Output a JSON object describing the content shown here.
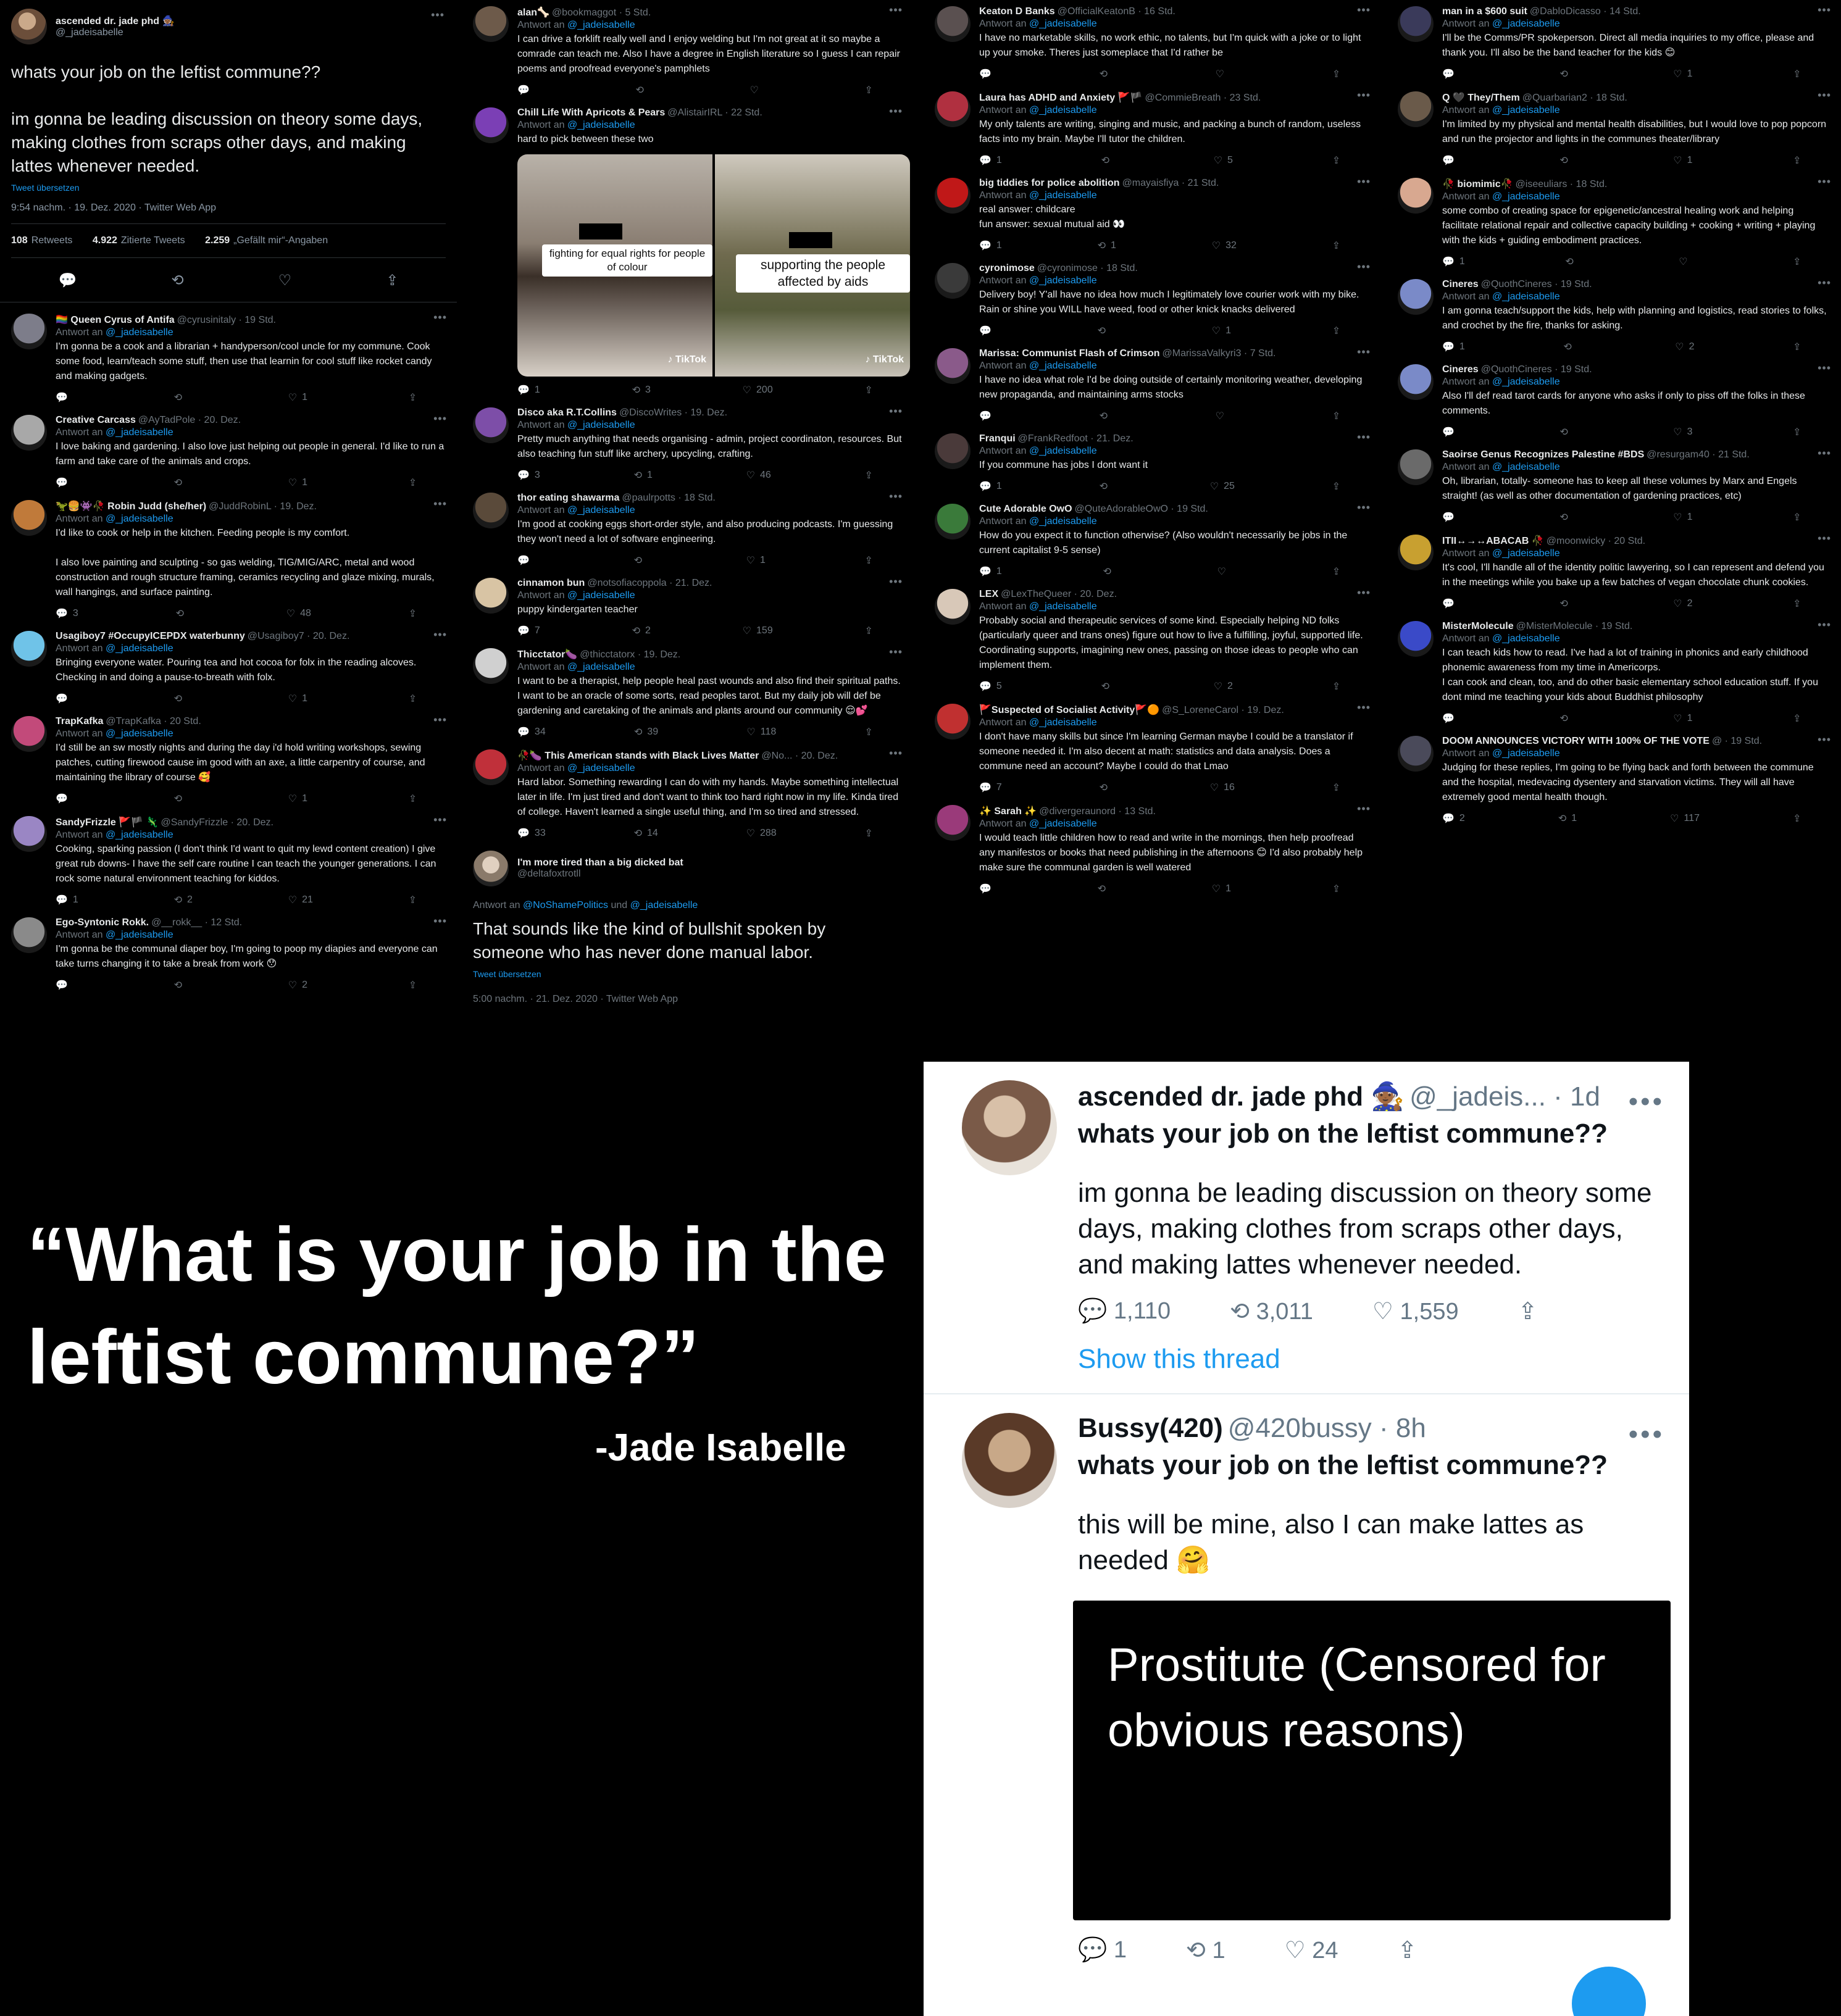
{
  "main_tweet": {
    "name": "ascended dr. jade phd 🧙🏾",
    "handle": "@_jadeisabelle",
    "text": "whats your job on the leftist commune??\n\nim gonna be leading discussion on theory some days, making clothes from scraps other days, and making lattes whenever needed.",
    "translate": "Tweet übersetzen",
    "meta": "9:54 nachm. · 19. Dez. 2020 · Twitter Web App",
    "retweets_count": "108",
    "retweets_label": "Retweets",
    "quotes_count": "4.922",
    "quotes_label": "Zitierte Tweets",
    "likes_count": "2.259",
    "likes_label": "„Gefällt mir“-Angaben"
  },
  "reply_prefix": "Antwort an",
  "reply_to": "@_jadeisabelle",
  "col1": [
    {
      "name": "🏳️‍🌈 Queen Cyrus of Antifa",
      "handle": "@cyrusinitaly · 19 Std.",
      "text": "I'm gonna be a cook and a librarian + handyperson/cool uncle for my commune. Cook some food, learn/teach some stuff, then use that learnin for cool stuff like rocket candy and making gadgets.",
      "reply": "",
      "rt": "",
      "like": "1",
      "color": "#7d7d8a"
    },
    {
      "name": "Creative Carcass",
      "handle": "@AyTadPole · 20. Dez.",
      "text": "I love baking and gardening. I also love just helping out people in general. I'd like to run a farm and take care of the animals and crops.",
      "reply": "",
      "rt": "",
      "like": "1",
      "color": "#a8a8a8"
    },
    {
      "name": "🦖🍔👾🥀 Robin Judd (she/her)",
      "handle": "@JuddRobinL · 19. Dez.",
      "text": "I'd like to cook or help in the kitchen. Feeding people is my comfort.\n\nI also love painting and sculpting - so gas welding, TIG/MIG/ARC, metal and wood construction and rough structure framing, ceramics recycling and glaze mixing, murals, wall hangings, and surface painting.",
      "reply": "3",
      "rt": "",
      "like": "48",
      "color": "#c07a3a"
    },
    {
      "name": "Usagiboy7 #OccupyICEPDX waterbunny",
      "handle": "@Usagiboy7 · 20. Dez.",
      "text": "Bringing everyone water. Pouring tea and hot cocoa for folx in the reading alcoves. Checking in and doing a pause-to-breath with folx.",
      "reply": "",
      "rt": "",
      "like": "1",
      "color": "#6fc3e8"
    },
    {
      "name": "TrapKafka",
      "handle": "@TrapKafka · 20 Std.",
      "text": "I'd still be an sw mostly nights and during the day i'd hold writing workshops, sewing patches, cutting firewood cause im good with an axe, a little carpentry of course, and maintaining the library of course 🥰",
      "reply": "",
      "rt": "",
      "like": "1",
      "color": "#c24a7a"
    },
    {
      "name": "SandyFrizzle 🚩🏴 🦎",
      "handle": "@SandyFrizzle · 20. Dez.",
      "text": "Cooking, sparking passion (I don't think I'd want to quit my lewd content creation) I give great rub downs- I have the self care routine I can teach the younger generations. I can rock some natural environment teaching for kiddos.",
      "reply": "1",
      "rt": "2",
      "like": "21",
      "color": "#9a86c4"
    },
    {
      "name": "Ego-Syntonic Rokk.",
      "handle": "@__rokk__ · 12 Std.",
      "text": "I'm gonna be the communal diaper boy, I'm going to poop my diapies and everyone can take turns changing it to take a break from work 😯",
      "reply": "",
      "rt": "",
      "like": "2",
      "color": "#8a8a8a"
    }
  ],
  "col2": [
    {
      "name": "alan🦴",
      "handle": "@bookmaggot · 5 Std.",
      "text": "I can drive a forklift really well and I enjoy welding but I'm not great at it so maybe a comrade can teach me. Also I have a degree in English literature so I guess I can repair poems and proofread everyone's pamphlets",
      "reply": "",
      "rt": "",
      "like": "",
      "color": "#6d5a4a"
    },
    {
      "name": "Chill Life With Apricots & Pears",
      "handle": "@AlistairIRL · 22 Std.",
      "text": "hard to pick between these two",
      "reply": "1",
      "rt": "3",
      "like": "200",
      "color": "#7b3fb5"
    },
    {
      "name": "Disco aka R.T.Collins",
      "handle": "@DiscoWrites · 19. Dez.",
      "text": "Pretty much anything that needs organising - admin, project coordinaton, resources. But also teaching fun stuff like archery, upcycling, crafting.",
      "reply": "3",
      "rt": "1",
      "like": "46",
      "color": "#7d4ea8"
    },
    {
      "name": "thor eating shawarma",
      "handle": "@paulrpotts · 18 Std.",
      "text": "I'm good at cooking eggs short-order style, and also producing podcasts. I'm guessing they won't need a lot of software engineering.",
      "reply": "",
      "rt": "",
      "like": "1",
      "color": "#5a4a3a"
    },
    {
      "name": "cinnamon bun",
      "handle": "@notsofiacoppola · 21. Dez.",
      "text": "puppy kindergarten teacher",
      "reply": "7",
      "rt": "2",
      "like": "159",
      "color": "#d8c4a4"
    },
    {
      "name": "Thicctator🍆",
      "handle": "@thicctatorx · 19. Dez.",
      "text": "I want to be a therapist, help people heal past wounds and also find their spiritual paths. I want to be an oracle of some sorts, read peoples tarot. But my daily job will def be gardening and caretaking of the animals and plants around our community 😌💕",
      "reply": "34",
      "rt": "39",
      "like": "118",
      "color": "#d0d0d0"
    },
    {
      "name": "🥀🍆 This American stands with Black Lives Matter",
      "handle": "@No... · 20. Dez.",
      "text": "Hard labor. Something rewarding I can do with my hands. Maybe something intellectual later in life. I'm just tired and don't want to think too hard right now in my life. Kinda tired  of college. Haven't learned a single useful thing, and I'm so tired and stressed.",
      "reply": "33",
      "rt": "14",
      "like": "288",
      "color": "#c0303a"
    }
  ],
  "media": {
    "caption_left": "fighting for equal rights for people of colour",
    "caption_right": "supporting the people affected by aids",
    "tiktok": "♪ TikTok"
  },
  "final_reply": {
    "name": "I'm more tired than a big dicked bat",
    "handle": "@deltafoxtrotll",
    "to_prefix": "Antwort an",
    "to_1": "@NoShamePolitics",
    "to_and": "und",
    "to_2": "@_jadeisabelle",
    "text": "That sounds like the kind of bullshit spoken by someone who has never done manual labor.",
    "translate": "Tweet übersetzen",
    "meta": "5:00 nachm. · 21. Dez. 2020 · Twitter Web App"
  },
  "col3": [
    {
      "name": "Keaton D Banks",
      "handle": "@OfficialKeatonB · 16 Std.",
      "text": "I have no marketable skills, no work ethic, no talents, but I'm quick with a joke or to light up your smoke. Theres just someplace that I'd rather be",
      "reply": "",
      "rt": "",
      "like": "",
      "color": "#5a5050"
    },
    {
      "name": "Laura has ADHD and Anxiety 🚩🏴",
      "handle": "@CommieBreath · 23 Std.",
      "text": "My only talents are writing, singing and music, and packing a bunch of random, useless facts into my brain. Maybe I'll tutor the children.",
      "reply": "1",
      "rt": "",
      "like": "5",
      "color": "#b03040"
    },
    {
      "name": "big tiddies for police abolition",
      "handle": "@mayaisfiya · 21 Std.",
      "text": "real answer: childcare\nfun answer: sexual mutual aid 👀",
      "reply": "1",
      "rt": "1",
      "like": "32",
      "color": "#c01818"
    },
    {
      "name": "cyronimose",
      "handle": "@cyronimose · 18 Std.",
      "text": "Delivery boy! Y'all have no idea how much I legitimately love courier work with my bike. Rain or shine you WILL have weed, food or other knick knacks delivered",
      "reply": "",
      "rt": "",
      "like": "1",
      "color": "#3a3a3a"
    },
    {
      "name": "Marissa: Communist Flash of Crimson",
      "handle": "@MarissaValkyri3 · 7 Std.",
      "text": "I have no idea what role I'd be doing outside of certainly monitoring weather, developing new propaganda, and maintaining arms stocks",
      "reply": "",
      "rt": "",
      "like": "",
      "color": "#8a5a8a"
    },
    {
      "name": "Franqui",
      "handle": "@FrankRedfoot · 21. Dez.",
      "text": "If you commune has jobs I dont want it",
      "reply": "1",
      "rt": "",
      "like": "25",
      "color": "#4a3a3a"
    },
    {
      "name": "Cute Adorable OwO",
      "handle": "@QuteAdorableOwO · 19 Std.",
      "text": "How do you expect it to function otherwise? (Also wouldn't necessarily be jobs in the current capitalist 9-5 sense)",
      "reply": "1",
      "rt": "",
      "like": "",
      "color": "#3a7a3a"
    },
    {
      "name": "LEX",
      "handle": "@LexTheQueer · 20. Dez.",
      "text": "Probably social and therapeutic services of some kind. Especially helping ND folks (particularly queer and trans ones) figure out how to live a fulfilling, joyful, supported life. Coordinating supports, imagining new ones, passing on those ideas to people who can implement them.",
      "reply": "5",
      "rt": "",
      "like": "2",
      "color": "#d8c8b8"
    },
    {
      "name": "🚩Suspected of Socialist Activity🚩🟠",
      "handle": "@S_LoreneCarol · 19. Dez.",
      "text": "I don't have many skills but since I'm learning German maybe I could be a translator if someone needed it. I'm also decent at math: statistics and data analysis. Does a commune need an account? Maybe I could do that Lmao",
      "reply": "7",
      "rt": "",
      "like": "16",
      "color": "#c03030"
    },
    {
      "name": "✨ Sarah ✨",
      "handle": "@divergeraunord · 13 Std.",
      "text": "I would teach little children how to read and write in the mornings, then help proofread any manifestos or books that need publishing in the afternoons 😊 I'd also probably help make sure the communal garden is well watered",
      "reply": "",
      "rt": "",
      "like": "1",
      "color": "#9a3a7a"
    }
  ],
  "col4": [
    {
      "name": "man in a $600 suit",
      "handle": "@DabloDicasso · 14 Std.",
      "text": "I'll be the Comms/PR spokeperson. Direct all media inquiries to my office, please and thank you. I'll also be the band teacher for the kids 😊",
      "reply": "",
      "rt": "",
      "like": "1",
      "color": "#3a3a5a"
    },
    {
      "name": "Q 🖤 They/Them",
      "handle": "@Quarbarian2 · 18 Std.",
      "text": "I'm limited by my physical and mental health disabilities, but I would love to pop popcorn and run the projector and lights in the communes theater/library",
      "reply": "",
      "rt": "",
      "like": "1",
      "color": "#6a5a4a"
    },
    {
      "name": "🥀 biomimic🥀",
      "handle": "@iseeuliars · 18 Std.",
      "text": "some combo of creating space for epigenetic/ancestral healing work and helping facilitate relational repair and collective capacity building + cooking + writing + playing with the kids + guiding embodiment practices.",
      "reply": "1",
      "rt": "",
      "like": "",
      "color": "#d8a890"
    },
    {
      "name": "Cineres",
      "handle": "@QuothCineres · 19 Std.",
      "text": "I am gonna teach/support the kids, help with planning and logistics, read stories to folks, and crochet by the fire, thanks for asking.",
      "reply": "1",
      "rt": "",
      "like": "2",
      "color": "#7a8ac8"
    },
    {
      "name": "Cineres",
      "handle": "@QuothCineres · 19 Std.",
      "text": "Also I'll def read tarot cards for anyone who asks if only to piss off the folks in these comments.",
      "reply": "",
      "rt": "",
      "like": "3",
      "color": "#7a8ac8"
    },
    {
      "name": "Saoirse Genus Recognizes Palestine #BDS",
      "handle": "@resurgam40 · 21 Std.",
      "text": "Oh, librarian, totally- someone has to keep all these volumes by Marx and Engels straight!  (as well as other documentation of gardening practices, etc)",
      "reply": "",
      "rt": "",
      "like": "1",
      "color": "#6a6a6a"
    },
    {
      "name": "ΙΤΙΙ↔→↔ABACAB 🥀",
      "handle": "@moonwicky · 20 Std.",
      "text": "It's cool, I'll handle all of the identity politic lawyering, so I can represent and defend you in the meetings while you bake up a few batches of vegan chocolate chunk cookies.",
      "reply": "",
      "rt": "",
      "like": "2",
      "color": "#c8a030"
    },
    {
      "name": "MisterMolecule",
      "handle": "@MisterMolecule · 19 Std.",
      "text": "I can teach kids how to read. I've had a lot of training in phonics and early childhood phonemic awareness from my time in Americorps.\nI can cook and clean, too, and do other basic elementary school education stuff. If you dont mind me teaching your kids about Buddhist philosophy",
      "reply": "",
      "rt": "",
      "like": "1",
      "color": "#3a4ac8"
    },
    {
      "name": "DOOM ANNOUNCES VICTORY WITH 100% OF THE VOTE",
      "handle": "@ · 19 Std.",
      "text": "Judging for these replies, I'm going to be flying back and forth between the commune and the hospital, medevacing dysentery and starvation victims. They will all have extremely good mental health though.",
      "reply": "2",
      "rt": "1",
      "like": "117",
      "color": "#4a4a5a"
    }
  ],
  "quote": {
    "text": "“What is your job in the leftist commune?”",
    "author": "-Jade Isabelle"
  },
  "light_tweets": [
    {
      "name": "ascended dr. jade phd 🧙🏾",
      "handle": "@_jadeis... · 1d",
      "head": "whats your job on the leftist commune??",
      "text": "im gonna be leading discussion on theory some days, making clothes from scraps other days, and making lattes whenever needed.",
      "reply": "1,110",
      "rt": "3,011",
      "like": "1,559",
      "show": "Show this thread"
    },
    {
      "name": "Bussy(420)",
      "handle": "@420bussy · 8h",
      "head": "whats your job on the leftist commune??",
      "text": "this will be mine, also I can make lattes as needed 🤗",
      "censored": "Prostitute (Censored for obvious reasons)",
      "reply": "1",
      "rt": "1",
      "like": "24"
    }
  ]
}
